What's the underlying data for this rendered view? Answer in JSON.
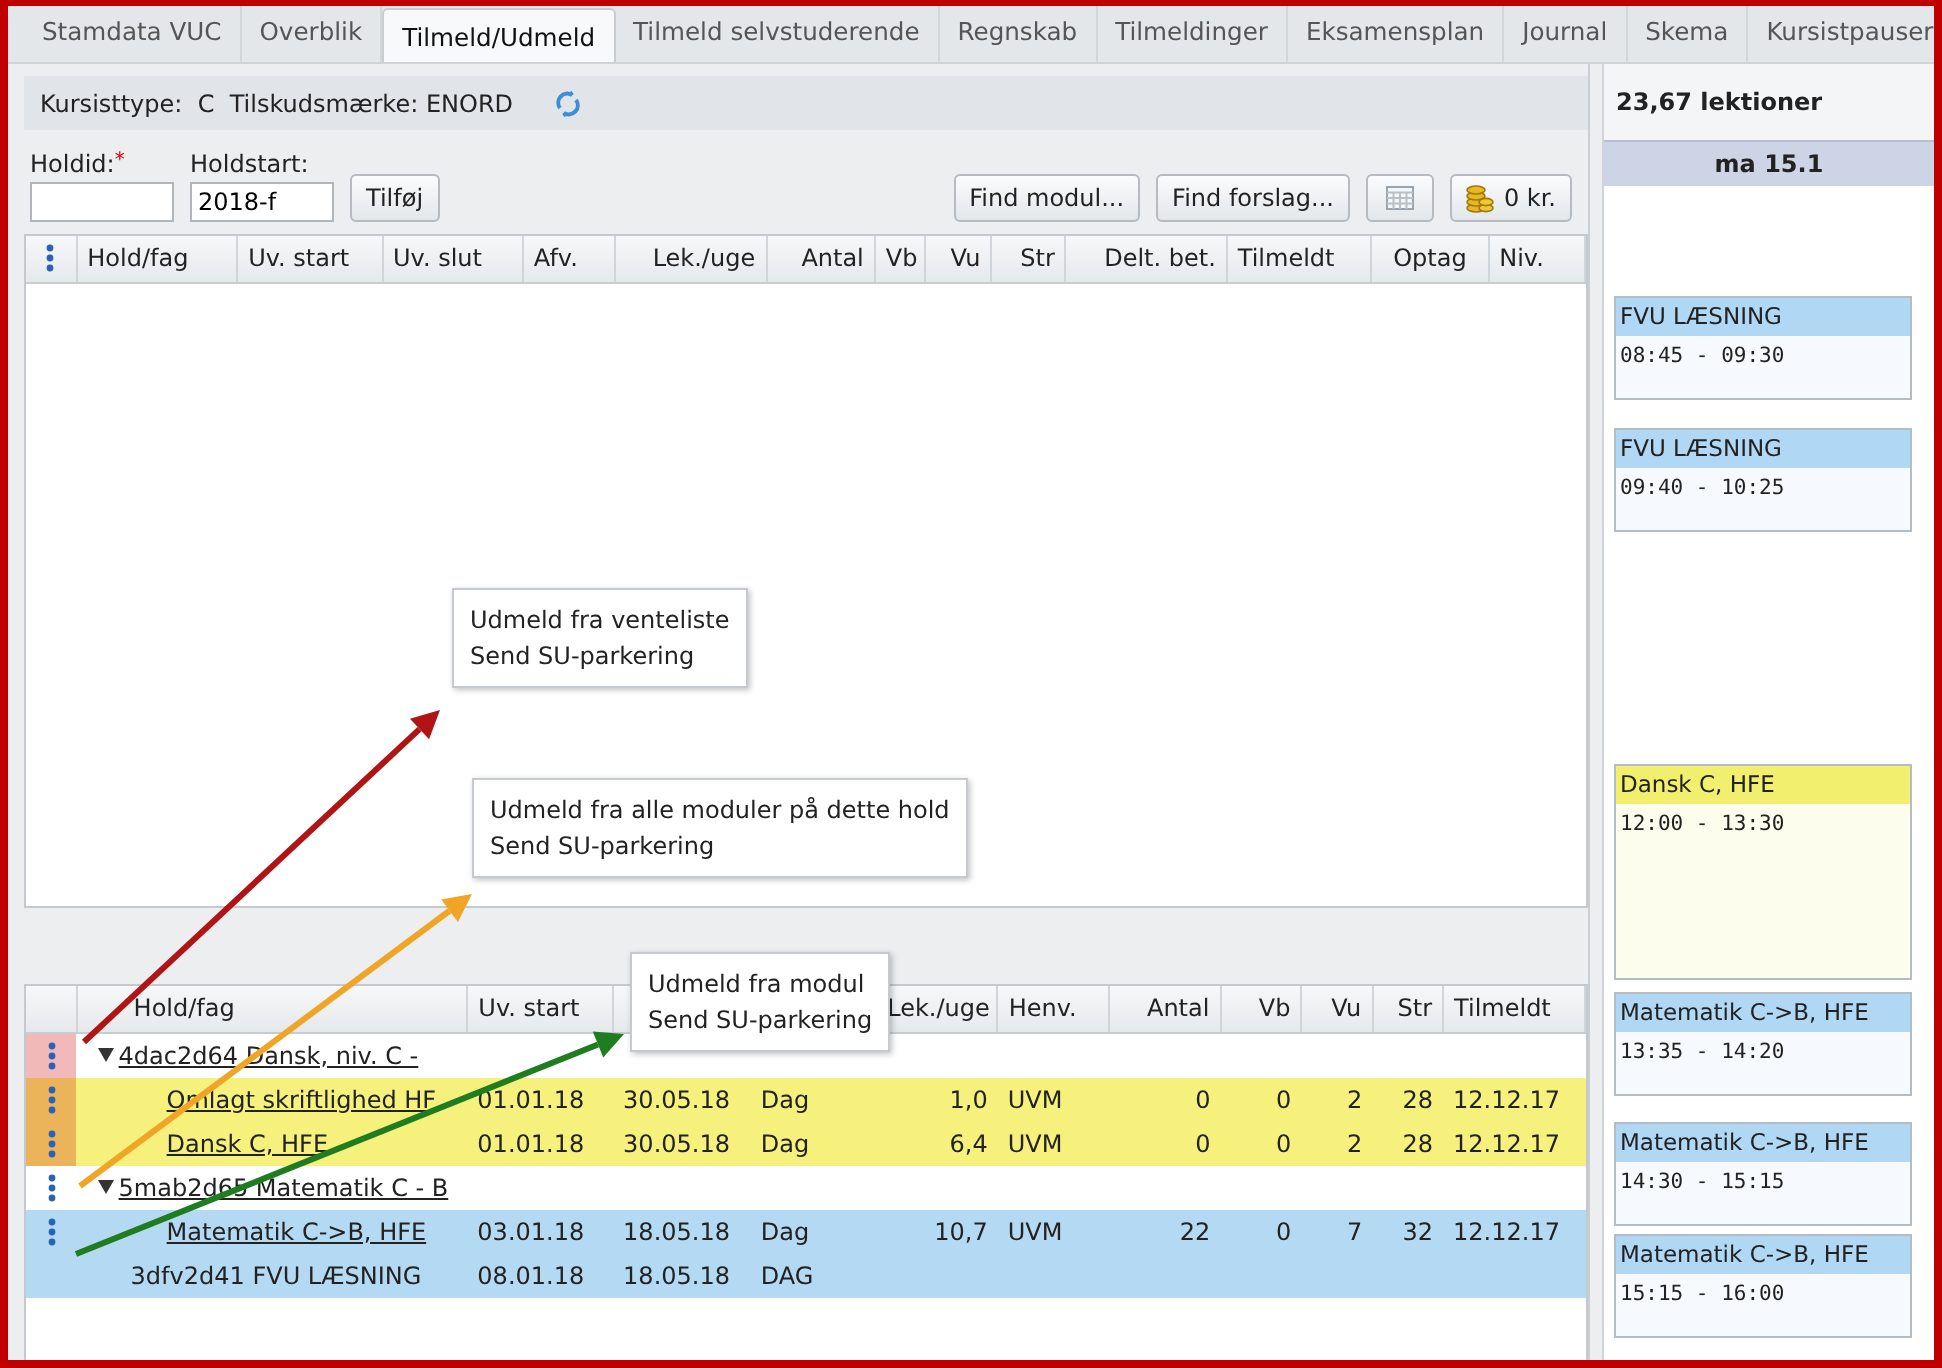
{
  "tabs": [
    {
      "label": "Stamdata VUC",
      "selected": false
    },
    {
      "label": "Overblik",
      "selected": false
    },
    {
      "label": "Tilmeld/Udmeld",
      "selected": true
    },
    {
      "label": "Tilmeld selvstuderende",
      "selected": false
    },
    {
      "label": "Regnskab",
      "selected": false
    },
    {
      "label": "Tilmeldinger",
      "selected": false
    },
    {
      "label": "Eksamensplan",
      "selected": false
    },
    {
      "label": "Journal",
      "selected": false
    },
    {
      "label": "Skema",
      "selected": false
    },
    {
      "label": "Kursistpauser",
      "selected": false
    }
  ],
  "info_bar": {
    "text": "Kursisttype:  C  Tilskudsmærke: ENORD"
  },
  "form": {
    "holdid": {
      "label": "Holdid:",
      "required_mark": "*"
    },
    "holdstart": {
      "label": "Holdstart:",
      "value": "2018-f"
    },
    "add_button": "Tilføj",
    "toolbar": [
      {
        "kind": "text",
        "label": "Find modul..."
      },
      {
        "kind": "text",
        "label": "Find forslag..."
      },
      {
        "kind": "calendar"
      },
      {
        "kind": "coins",
        "label": "0 kr."
      }
    ]
  },
  "top_table": {
    "columns": [
      "Hold/fag",
      "Uv. start",
      "Uv. slut",
      "Afv.",
      "Lek./uge",
      "Antal",
      "Vb",
      "Vu",
      "Str",
      "Delt. bet.",
      "Tilmeldt",
      "Optag",
      "Niv."
    ]
  },
  "bottom_table": {
    "columns": [
      {
        "label": "Hold/fag"
      },
      {
        "label": "Uv. start"
      },
      {},
      {},
      {
        "label": "Lek./uge"
      },
      {
        "label": "Henv."
      },
      {
        "label": "Antal"
      },
      {
        "label": "Vb"
      },
      {
        "label": "Vu"
      },
      {
        "label": "Str"
      },
      {
        "label": "Tilmeldt"
      }
    ],
    "rows": [
      {
        "kind": "group",
        "expanded": true,
        "marker": {
          "color": "#f2b9b9"
        },
        "cells": [
          "4dac2d64 Dansk, niv. C -"
        ]
      },
      {
        "kind": "module",
        "color": "#f6f07c",
        "marker": {
          "color": "#ebb35a"
        },
        "cells": [
          "Omlagt skriftlighed HF",
          "01.01.18",
          "30.05.18",
          "Dag",
          "1,0",
          "UVM",
          "0",
          "0",
          "2",
          "28",
          "12.12.17"
        ]
      },
      {
        "kind": "module",
        "color": "#f6f07c",
        "marker": {
          "color": "#ebb35a"
        },
        "cells": [
          "Dansk C, HFE",
          "01.01.18",
          "30.05.18",
          "Dag",
          "6,4",
          "UVM",
          "0",
          "0",
          "2",
          "28",
          "12.12.17"
        ]
      },
      {
        "kind": "group",
        "expanded": true,
        "marker": {},
        "cells": [
          "5mab2d65 Matematik C - B"
        ]
      },
      {
        "kind": "module",
        "color": "#b4daf3",
        "marker": {},
        "cells": [
          "Matematik C->B, HFE",
          "03.01.18",
          "18.05.18",
          "Dag",
          "10,7",
          "UVM",
          "22",
          "0",
          "7",
          "32",
          "12.12.17"
        ]
      },
      {
        "kind": "plain",
        "color": "#b4daf3",
        "cells": [
          "3dfv2d41 FVU LÆSNING",
          "08.01.18",
          "18.05.18",
          "DAG"
        ]
      }
    ]
  },
  "arrows": [
    {
      "color": "#b01414"
    },
    {
      "color": "#f0a526"
    },
    {
      "color": "#1f7d1f"
    }
  ],
  "menus": [
    [
      "Udmeld fra venteliste",
      "Send SU-parkering"
    ],
    [
      "Udmeld fra alle moduler på dette hold",
      "Send SU-parkering"
    ],
    [
      "Udmeld fra modul",
      "Send SU-parkering"
    ]
  ],
  "schedule": {
    "total": "23,67 lektioner",
    "day": "ma 15.1",
    "events": [
      {
        "title": "FVU LÆSNING",
        "time": "08:45 - 09:30",
        "color": "#b0d8f5"
      },
      {
        "title": "FVU LÆSNING",
        "time": "09:40 - 10:25",
        "color": "#b0d8f5"
      },
      {
        "title": "Dansk C, HFE",
        "time": "12:00 - 13:30",
        "color": "#f2ef6e"
      },
      {
        "title": "Matematik C->B, HFE",
        "time": "13:35 - 14:20",
        "color": "#b0d8f5"
      },
      {
        "title": "Matematik C->B, HFE",
        "time": "14:30 - 15:15",
        "color": "#b0d8f5"
      },
      {
        "title": "Matematik C->B, HFE",
        "time": "15:15 - 16:00",
        "color": "#b0d8f5"
      }
    ]
  }
}
